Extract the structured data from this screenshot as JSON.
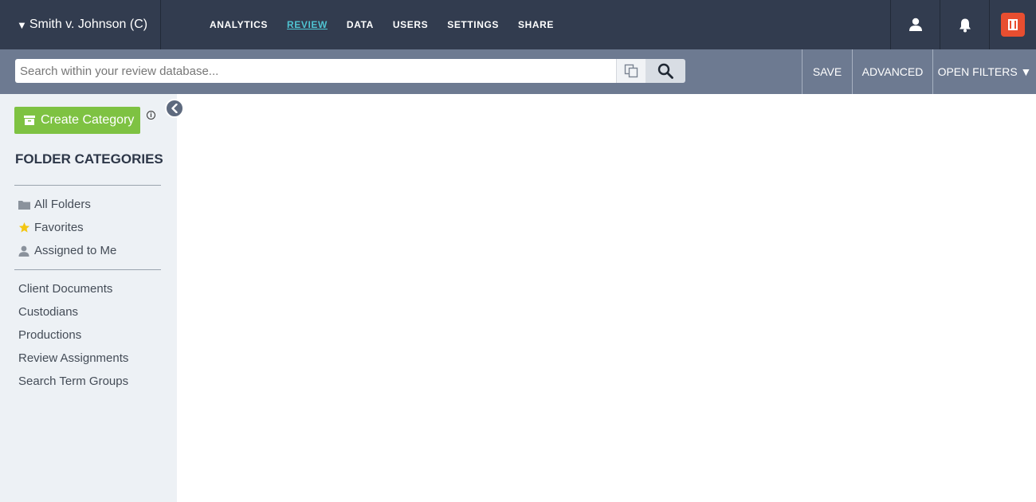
{
  "header": {
    "case_name": "Smith v. Johnson (C)",
    "nav": [
      {
        "label": "ANALYTICS",
        "active": false
      },
      {
        "label": "REVIEW",
        "active": true
      },
      {
        "label": "DATA",
        "active": false
      },
      {
        "label": "USERS",
        "active": false
      },
      {
        "label": "SETTINGS",
        "active": false
      },
      {
        "label": "SHARE",
        "active": false
      }
    ],
    "icons": [
      "user-icon",
      "bell-icon",
      "app-logo"
    ],
    "colors": {
      "bar": "#323c4f",
      "active_nav": "#4fc3d1",
      "logo": "#e84e30"
    }
  },
  "search": {
    "placeholder": "Search within your review database...",
    "value": "",
    "save_label": "SAVE",
    "advanced_label": "ADVANCED",
    "filters_label": "OPEN FILTERS ▼"
  },
  "sidebar": {
    "create_label": "Create Category",
    "title": "FOLDER CATEGORIES",
    "quick_items": [
      {
        "label": "All Folders",
        "icon": "folder-icon"
      },
      {
        "label": "Favorites",
        "icon": "star-icon"
      },
      {
        "label": "Assigned to Me",
        "icon": "person-icon"
      }
    ],
    "categories": [
      {
        "label": "Client Documents"
      },
      {
        "label": "Custodians"
      },
      {
        "label": "Productions"
      },
      {
        "label": "Review Assignments"
      },
      {
        "label": "Search Term Groups"
      }
    ],
    "colors": {
      "create_button": "#7ec242",
      "background": "#edf1f5"
    }
  }
}
